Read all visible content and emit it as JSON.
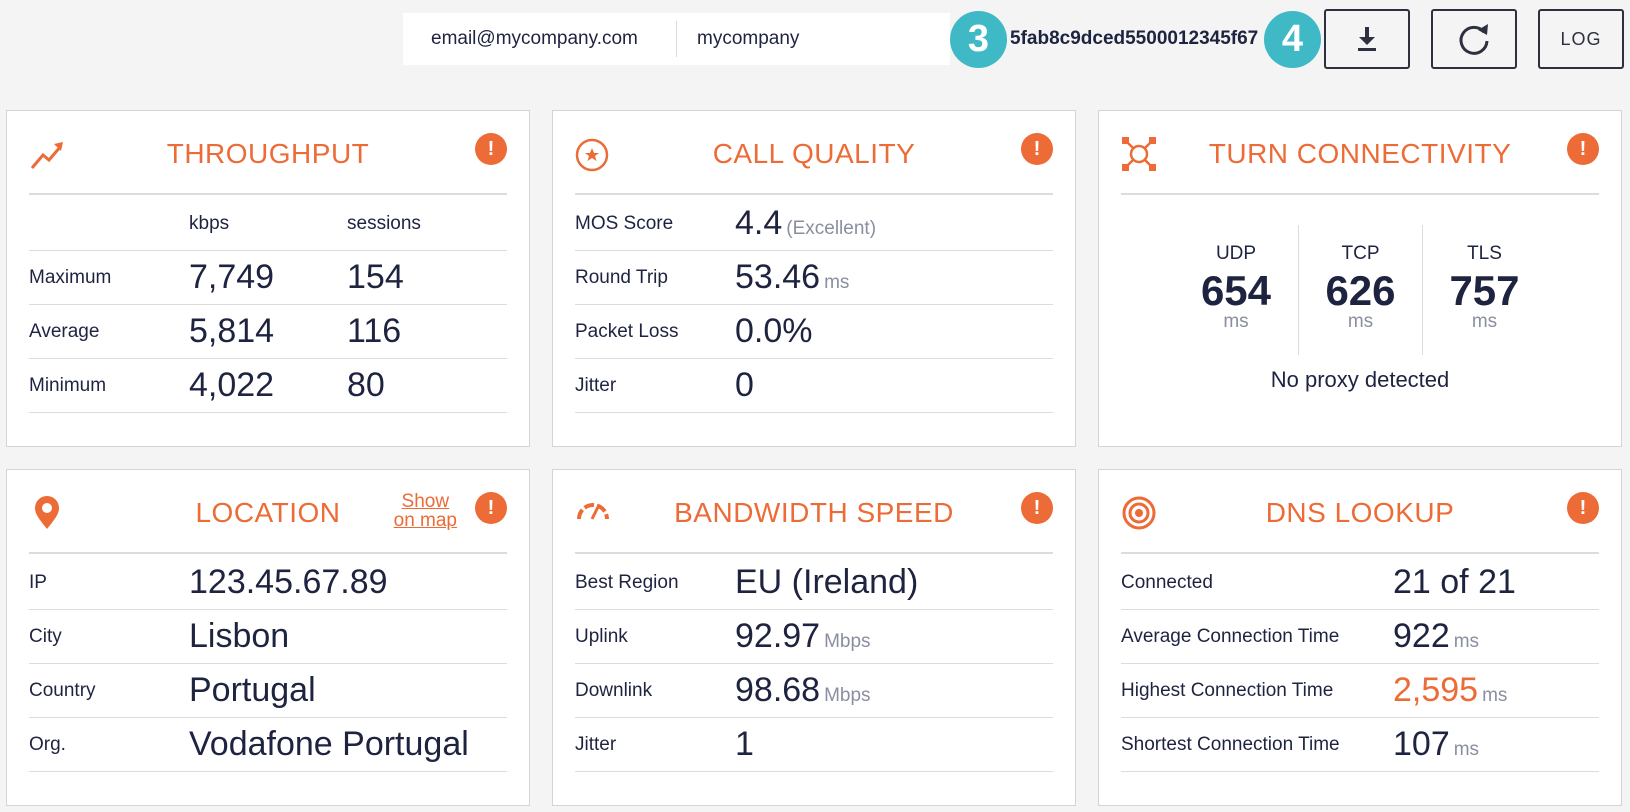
{
  "header": {
    "email": "email@mycompany.com",
    "company": "mycompany",
    "step_a": "3",
    "session_id": "5fab8c9dced5500012345f67",
    "step_b": "4",
    "log_label": "LOG",
    "icons": {
      "download": "download-icon",
      "refresh": "refresh-icon"
    }
  },
  "colors": {
    "accent": "#ec6b36",
    "step": "#3fb9c6",
    "text": "#1e2440",
    "unit": "#8a8fa0"
  },
  "throughput": {
    "title": "THROUGHPUT",
    "col_kbps": "kbps",
    "col_sessions": "sessions",
    "rows": [
      {
        "label": "Maximum",
        "kbps": "7,749",
        "sessions": "154"
      },
      {
        "label": "Average",
        "kbps": "5,814",
        "sessions": "116"
      },
      {
        "label": "Minimum",
        "kbps": "4,022",
        "sessions": "80"
      }
    ]
  },
  "call_quality": {
    "title": "CALL QUALITY",
    "rows": [
      {
        "label": "MOS Score",
        "value": "4.4",
        "unit": "(Excellent)"
      },
      {
        "label": "Round Trip",
        "value": "53.46",
        "unit": "ms"
      },
      {
        "label": "Packet Loss",
        "value": "0.0%",
        "unit": ""
      },
      {
        "label": "Jitter",
        "value": "0",
        "unit": ""
      }
    ]
  },
  "turn": {
    "title": "TURN CONNECTIVITY",
    "protocols": [
      {
        "name": "UDP",
        "value": "654",
        "unit": "ms"
      },
      {
        "name": "TCP",
        "value": "626",
        "unit": "ms"
      },
      {
        "name": "TLS",
        "value": "757",
        "unit": "ms"
      }
    ],
    "note": "No proxy detected"
  },
  "location": {
    "title": "LOCATION",
    "map_link_line1": "Show",
    "map_link_line2": "on map",
    "rows": [
      {
        "label": "IP",
        "value": "123.45.67.89"
      },
      {
        "label": "City",
        "value": "Lisbon"
      },
      {
        "label": "Country",
        "value": "Portugal"
      },
      {
        "label": "Org.",
        "value": "Vodafone Portugal"
      }
    ]
  },
  "bandwidth": {
    "title": "BANDWIDTH SPEED",
    "rows": [
      {
        "label": "Best Region",
        "value": "EU (Ireland)",
        "unit": ""
      },
      {
        "label": "Uplink",
        "value": "92.97",
        "unit": "Mbps"
      },
      {
        "label": "Downlink",
        "value": "98.68",
        "unit": "Mbps"
      },
      {
        "label": "Jitter",
        "value": "1",
        "unit": ""
      }
    ]
  },
  "dns": {
    "title": "DNS LOOKUP",
    "rows": [
      {
        "label": "Connected",
        "value": "21 of 21",
        "unit": ""
      },
      {
        "label": "Average Connection Time",
        "value": "922",
        "unit": "ms"
      },
      {
        "label": "Highest Connection Time",
        "value": "2,595",
        "unit": "ms"
      },
      {
        "label": "Shortest Connection Time",
        "value": "107",
        "unit": "ms"
      }
    ]
  },
  "alert_glyph": "!"
}
